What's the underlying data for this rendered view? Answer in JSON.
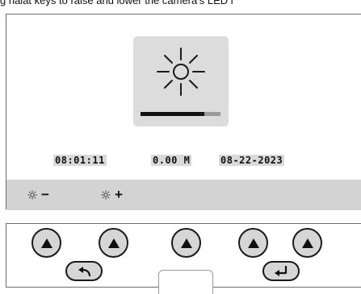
{
  "caption": "g halat keys to raise and lower the camera's LED i",
  "screen": {
    "brightness_icon": "sun-icon",
    "brightness_level": 0.8,
    "time": "08:01:11",
    "distance": "0.00 M",
    "date": "08-22-2023"
  },
  "status_bar": {
    "decrease": {
      "icon": "small-sun-icon",
      "sign": "−"
    },
    "increase": {
      "icon": "small-sun-icon",
      "sign": "+"
    }
  },
  "keypad": {
    "keys": [
      "up-arrow-icon",
      "up-arrow-icon",
      "up-arrow-icon",
      "up-arrow-icon",
      "up-arrow-icon"
    ],
    "back_icon": "back-arrow-icon",
    "enter_icon": "enter-icon"
  },
  "colors": {
    "tile": "#dcdcdc",
    "bar": "#d3d3d3",
    "button": "#d6d6d6",
    "outline": "#1a1a1a"
  }
}
